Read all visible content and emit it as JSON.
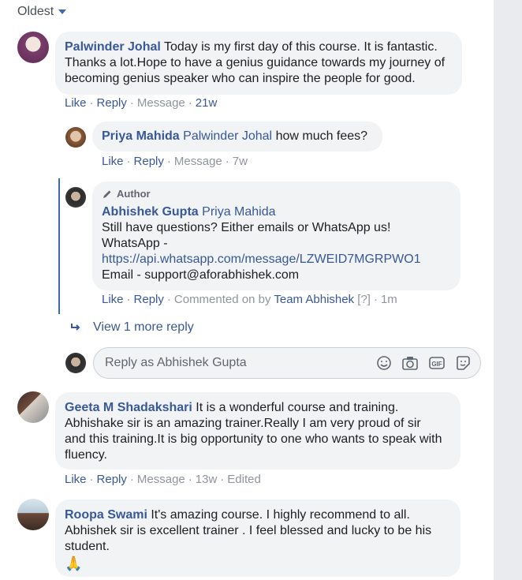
{
  "sort": {
    "label": "Oldest"
  },
  "comments": [
    {
      "author": "Palwinder Johal",
      "text_lines": [
        "Today is my first day of this course. It is fantastic.",
        "Thanks a lot.Hope to have a genius guidance towards my journey of",
        "becoming genius speaker who can inspire the people for good."
      ],
      "actions": {
        "like": "Like",
        "reply": "Reply",
        "message": "Message",
        "time": "21w"
      }
    },
    {
      "author": "Priya Mahida",
      "mention": "Palwinder Johal",
      "text": "how much fees?",
      "actions": {
        "like": "Like",
        "reply": "Reply",
        "message": "Message",
        "time": "7w"
      }
    },
    {
      "badge": "Author",
      "author": "Abhishek Gupta",
      "mention": "Priya Mahida",
      "lines": [
        "Still have questions? Either emails or WhatsApp us!",
        "WhatsApp -"
      ],
      "link": "https://api.whatsapp.com/message/LZWEID7MGRPWO1",
      "email_line": "Email - support@aforabhishek.com",
      "actions": {
        "like": "Like",
        "reply": "Reply",
        "commented_on_by": "Commented on by",
        "team": "Team Abhishek",
        "help": "[?]",
        "time": "1m"
      }
    },
    {
      "author": "Geeta M Shadakshari",
      "text_lines": [
        "It is a wonderful course and training.",
        "Abhishake sir is an amazing trainer.Really I am very proud of sir",
        "and this training.It is big opportunity to one who wants to speak with",
        "fluency."
      ],
      "actions": {
        "like": "Like",
        "reply": "Reply",
        "message": "Message",
        "time": "13w",
        "edited": "Edited"
      }
    },
    {
      "author": "Roopa Swami",
      "text_lines": [
        "It's amazing course. I highly recommend to all.",
        "Abhishek sir is excellent trainer . I feel blessed and lucky to be his",
        "student."
      ],
      "emoji": "🙏"
    }
  ],
  "view_more": "View 1 more reply",
  "reply_box": {
    "placeholder": "Reply as Abhishek Gupta"
  },
  "icons": [
    "emoji-icon",
    "camera-icon",
    "gif-icon",
    "sticker-icon",
    "pencil-icon",
    "reply-arrow-icon"
  ]
}
